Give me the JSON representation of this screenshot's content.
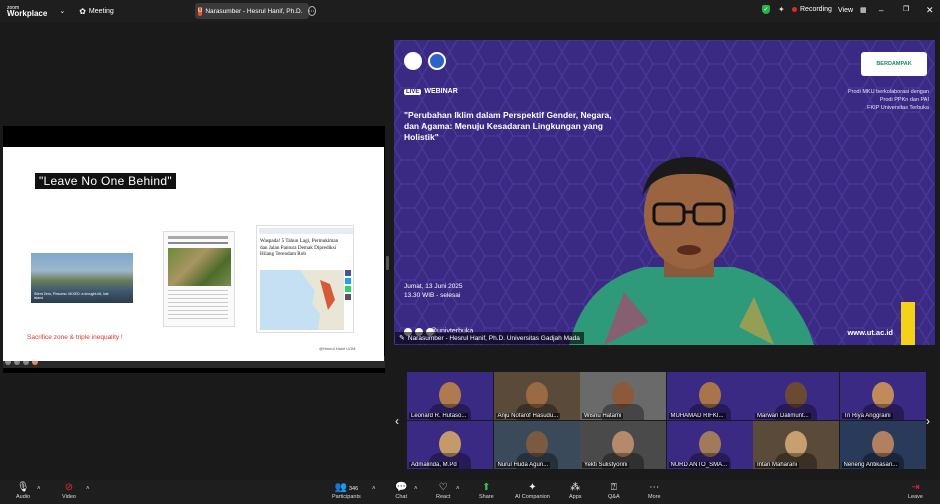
{
  "topbar": {
    "logo_line1": "zoom",
    "logo_line2": "Workplace",
    "meeting_label": "Meeting",
    "tab_title": "Narasumber - Hesrul Hanif, Ph.D.",
    "recording_label": "Recording",
    "view_label": "View"
  },
  "slide": {
    "title": "\"Leave No One Behind\"",
    "footer": "Sacrifice zone & triple inequality !",
    "credit": "@Hesrul Hanif UGM",
    "article1_caption": "Silent Zero, Pinsumo: MIXED: a drought-hit, lost island",
    "article3_headline": "Waspada! 5 Tahun Lagi, Permukiman dan Jalan Pantura Demak Diprediksi Hilang Terendam Rob"
  },
  "speaker_view": {
    "live_badge": "LIVE",
    "webinar_label": "WEBINAR",
    "title": "\"Perubahan Iklim dalam Perspektif Gender, Negara, dan Agama: Menuju Kesadaran Lingkungan yang Holistik\"",
    "prodi_1": "Prodi MKU berkolaborasi dengan",
    "prodi_2": "Prodi PPKn dan PAI",
    "prodi_3": "FKIP Universitas Terbuka",
    "date": "Jumat, 13 Juni 2025",
    "time": "13.30 WIB - selesai",
    "handle": "@univterbuka",
    "url": "www.ut.ac.id",
    "badge": "BERDAMPAK",
    "name": "Narasumber - Hesrul Hanif, Ph.D. Universitas Gadjah Mada"
  },
  "participants": [
    {
      "name": "Leonard R. Hutaso..."
    },
    {
      "name": "Anju Nofarof Hasudu..."
    },
    {
      "name": "Wisnu Hatami"
    },
    {
      "name": "MUHAMAD RIFKI..."
    },
    {
      "name": "Marwan Dalimunt..."
    },
    {
      "name": "Tri Riya Anggraini"
    },
    {
      "name": "Admalinda, M.Pd"
    },
    {
      "name": "Nurul Huda Agun..."
    },
    {
      "name": "Yekti Sulistyorini"
    },
    {
      "name": "NURD ANTO_SMA..."
    },
    {
      "name": "Intan Maharani"
    },
    {
      "name": "Neneng Antikasari..."
    }
  ],
  "toolbar": {
    "audio": "Audio",
    "video": "Video",
    "participants": "Participants",
    "participants_count": "346",
    "chat": "Chat",
    "react": "React",
    "share": "Share",
    "ai": "AI Companion",
    "apps": "Apps",
    "qa": "Q&A",
    "more": "More",
    "leave": "Leave"
  }
}
